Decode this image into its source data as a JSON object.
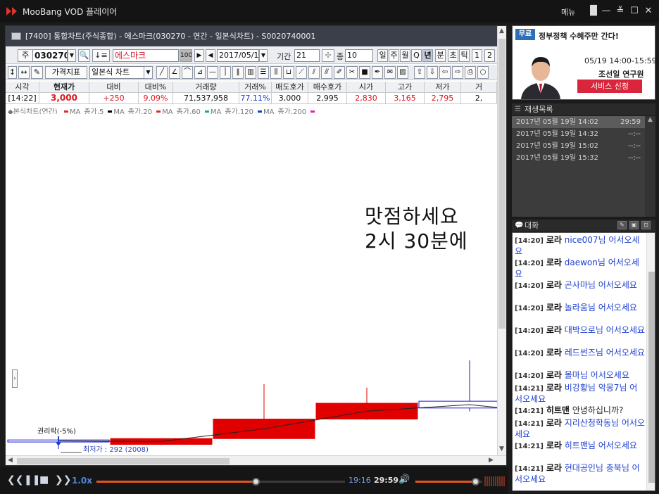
{
  "app": {
    "title": "MooBang VOD 플레이어",
    "menu_label": "메뉴"
  },
  "window_controls": {
    "layout": "▐▌",
    "minimize": "—",
    "collapse": "≚",
    "maximize": "☐",
    "close": "✕"
  },
  "document": {
    "title": "[7400] 통합차트(주식종합) - 에스마크(030270 - 연간 - 일본식차트) - S0020740001"
  },
  "toolbar": {
    "code_prefix": "주",
    "stock_code": "030270",
    "stock_name": "에스마크",
    "stock_badge": "100",
    "date": "2017/05/19",
    "period_label": "기간",
    "period_value": "21",
    "count_label": "종",
    "count_value": "10",
    "interval_buttons": [
      "일",
      "주",
      "월",
      "Q",
      "년",
      "분",
      "초",
      "틱",
      "1",
      "2"
    ],
    "selected_interval": "년",
    "price_indicator_label": "가격지표",
    "chart_type": "일본식 차트"
  },
  "quote": {
    "headers": [
      "시각",
      "현재가",
      "대비",
      "대비%",
      "거래량",
      "거래%",
      "매도호가",
      "매수호가",
      "시가",
      "고가",
      "저가",
      "거"
    ],
    "values": [
      "[14:22]",
      "3,000",
      "+250",
      "9.09%",
      "71,537,958",
      "77.11%",
      "3,000",
      "2,995",
      "2,830",
      "3,165",
      "2,795",
      "2,"
    ]
  },
  "legend": {
    "chart_label": "◆본식차트(연간)",
    "items": [
      {
        "label": "MA_종가,5",
        "color": "#e0282e"
      },
      {
        "label": "MA_종가,20",
        "color": "#000000"
      },
      {
        "label": "MA_종가,60",
        "color": "#e0282e"
      },
      {
        "label": "MA_종가,120",
        "color": "#19b34a"
      },
      {
        "label": "MA_종가,200",
        "color": "#1a3fd0"
      },
      {
        "label": "",
        "color": "#e020c8"
      }
    ]
  },
  "overlay_text": {
    "line1": "맛점하세요",
    "line2": "2시  30분에"
  },
  "chart": {
    "annotation_rights": "권리락(-5%)",
    "annotation_low": "최저가 : 292 (2008)",
    "up_color": "#e00000",
    "down_color": "#1a1acc",
    "candles": [
      {
        "open": 820,
        "close": 700,
        "high": 860,
        "low": 292
      },
      {
        "open": 560,
        "close": 900,
        "high": 920,
        "low": 520
      },
      {
        "open": 900,
        "close": 2050,
        "high": 4100,
        "low": 880
      },
      {
        "open": 2050,
        "close": 2980,
        "high": 3900,
        "low": 2000
      },
      {
        "open": 3100,
        "close": 2700,
        "high": 5500,
        "low": 2500
      },
      {
        "open": 2700,
        "close": 1850,
        "high": 3700,
        "low": 1600
      }
    ],
    "ylim": [
      0,
      20000
    ]
  },
  "player": {
    "speed": "1.0x",
    "current_time": "19:16",
    "total_time": "29:59",
    "progress_fraction": 0.643,
    "volume_fraction": 0.9
  },
  "ad": {
    "badge": "무료",
    "headline": "정부정책 수혜주만 간다!",
    "schedule": "05/19  14:00-15:59",
    "speaker": "조선일 연구원",
    "apply_button": "서비스 신청"
  },
  "playlist": {
    "title": "재생목록",
    "items": [
      {
        "label": "2017년 05월 19일 14:02",
        "duration": "29:59",
        "active": true
      },
      {
        "label": "2017년 05월 19일 14:32",
        "duration": "--:--",
        "active": false
      },
      {
        "label": "2017년 05월 19일 15:02",
        "duration": "--:--",
        "active": false
      },
      {
        "label": "2017년 05월 19일 15:32",
        "duration": "--:--",
        "active": false
      }
    ]
  },
  "chat": {
    "title": "대화",
    "messages": [
      {
        "time": "[14:20]",
        "nick": "로라",
        "text": "nice007님 어서오세요",
        "plain": false
      },
      {
        "time": "[14:20]",
        "nick": "로라",
        "text": "daewon님 어서오세요",
        "plain": false
      },
      {
        "time": "[14:20]",
        "nick": "로라",
        "text": "곤사마님 어서오세요",
        "plain": false
      },
      {
        "time": "[14:20]",
        "nick": "로라",
        "text": "놀라움님 어서오세요",
        "plain": false
      },
      {
        "time": "[14:20]",
        "nick": "로라",
        "text": "대박으로님 어서오세요",
        "plain": false
      },
      {
        "time": "[14:20]",
        "nick": "로라",
        "text": "레드썬즈님 어서오세요",
        "plain": false
      },
      {
        "time": "[14:20]",
        "nick": "로라",
        "text": "몰마님 어서오세요",
        "plain": false
      },
      {
        "time": "[14:21]",
        "nick": "로라",
        "text": "비강황님 악몽7님 어서오세요",
        "plain": false
      },
      {
        "time": "[14:21]",
        "nick": "히트맨",
        "text": "안녕하십니까?",
        "plain": true
      },
      {
        "time": "[14:21]",
        "nick": "로라",
        "text": "지리산청학동님 어서오세요",
        "plain": false
      },
      {
        "time": "[14:21]",
        "nick": "로라",
        "text": "히트맨님 어서오세요",
        "plain": false
      },
      {
        "time": "[14:21]",
        "nick": "로라",
        "text": "현대공인님 충북님 어서오세요",
        "plain": false
      }
    ]
  }
}
